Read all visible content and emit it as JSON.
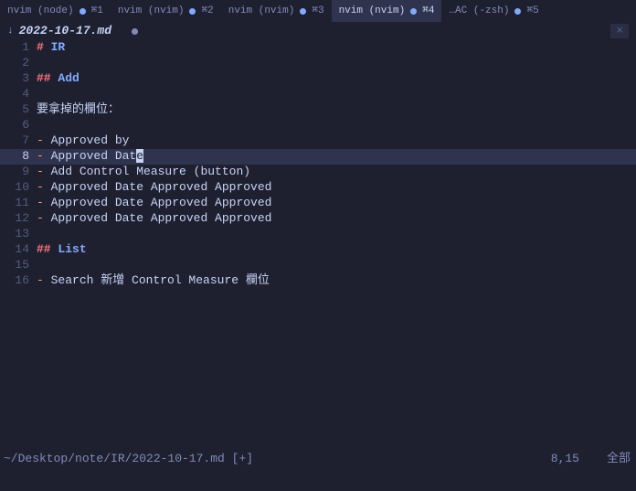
{
  "tabs": [
    {
      "title": "nvim (node)",
      "shortcut": "⌘1",
      "active": false
    },
    {
      "title": "nvim (nvim)",
      "shortcut": "⌘2",
      "active": false
    },
    {
      "title": "nvim (nvim)",
      "shortcut": "⌘3",
      "active": false
    },
    {
      "title": "nvim (nvim)",
      "shortcut": "⌘4",
      "active": true
    },
    {
      "title": "…AC (-zsh)",
      "shortcut": "⌘5",
      "active": false
    }
  ],
  "buffer": {
    "arrow": "↓",
    "filename": "2022-10-17.md",
    "close": "×"
  },
  "lines": [
    {
      "n": "1",
      "type": "h1",
      "hash": "#",
      "text": " IR"
    },
    {
      "n": "2",
      "type": "empty"
    },
    {
      "n": "3",
      "type": "h2",
      "hash": "##",
      "text": " Add"
    },
    {
      "n": "4",
      "type": "empty"
    },
    {
      "n": "5",
      "type": "text",
      "text": "要拿掉的欄位："
    },
    {
      "n": "6",
      "type": "empty"
    },
    {
      "n": "7",
      "type": "bullet",
      "text": "Approved by"
    },
    {
      "n": "8",
      "type": "bullet-cursor",
      "text": "Approved Dat",
      "cursor": "e",
      "current": true
    },
    {
      "n": "9",
      "type": "bullet",
      "text": "Add Control Measure (button)"
    },
    {
      "n": "10",
      "type": "bullet",
      "text": "Approved Date Approved Approved"
    },
    {
      "n": "11",
      "type": "bullet",
      "text": "Approved Date Approved Approved"
    },
    {
      "n": "12",
      "type": "bullet",
      "text": "Approved Date Approved Approved"
    },
    {
      "n": "13",
      "type": "empty"
    },
    {
      "n": "14",
      "type": "h2",
      "hash": "##",
      "text": " List"
    },
    {
      "n": "15",
      "type": "empty"
    },
    {
      "n": "16",
      "type": "bullet",
      "text": "Search 新增 Control Measure 欄位"
    }
  ],
  "status": {
    "path": "~/Desktop/note/IR/2022-10-17.md [+]",
    "position": "8,15",
    "scroll": "全部"
  }
}
